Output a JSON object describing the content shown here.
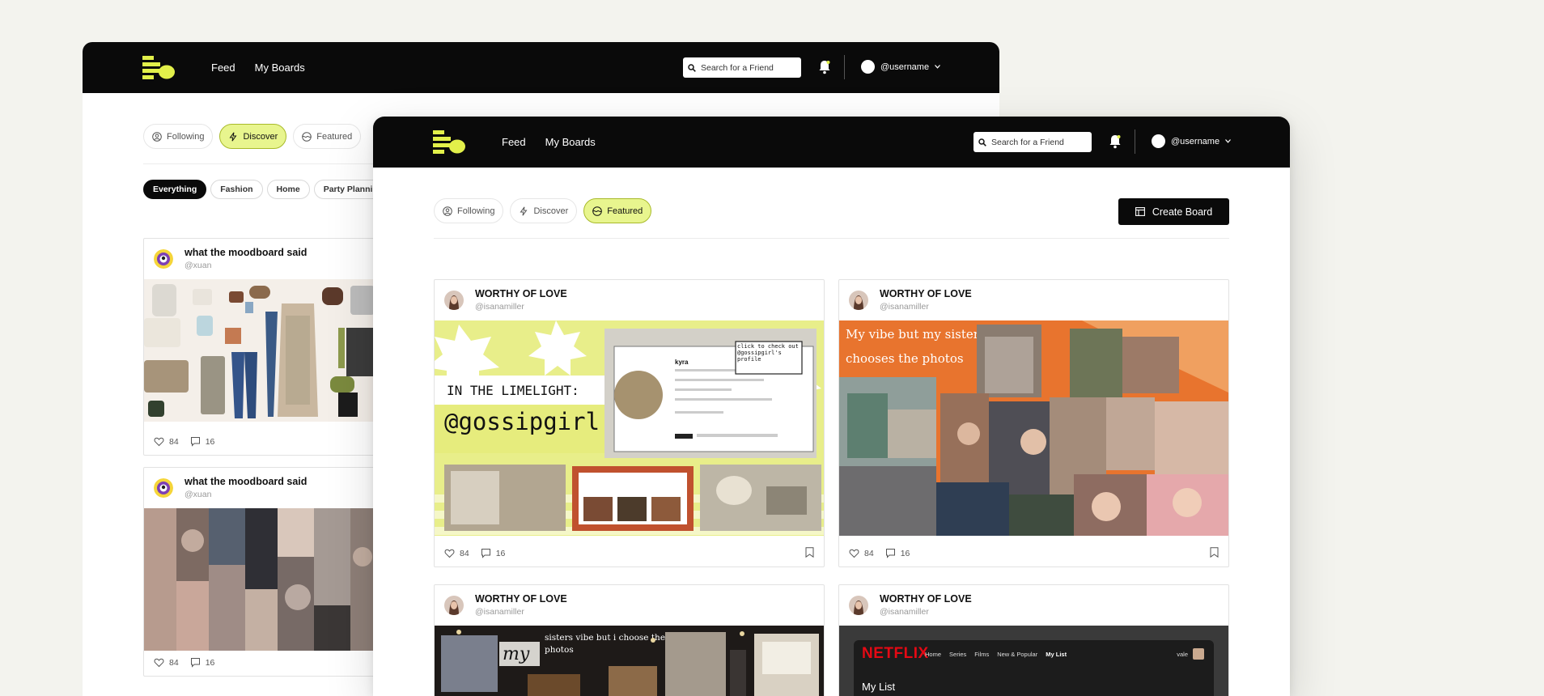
{
  "colors": {
    "accent": "#e8f58e",
    "dark": "#0a0a0a",
    "background": "#f3f3ee"
  },
  "nav": {
    "feed": "Feed",
    "boards": "My Boards"
  },
  "search": {
    "placeholder": "Search for a Friend"
  },
  "user": {
    "name": "@username"
  },
  "tabs": {
    "following": "Following",
    "discover": "Discover",
    "featured": "Featured"
  },
  "back": {
    "active_tab": "Discover",
    "chips": [
      "Everything",
      "Fashion",
      "Home",
      "Party Planning"
    ],
    "cards": [
      {
        "title": "what the moodboard said",
        "handle": "@xuan",
        "likes": "84",
        "comments": "16"
      },
      {
        "title": "what the moodboard said",
        "handle": "@xuan",
        "likes": "84",
        "comments": "16"
      }
    ]
  },
  "front": {
    "active_tab": "Featured",
    "create_label": "Create Board",
    "cards": [
      {
        "title": "WORTHY OF LOVE",
        "handle": "@isanamiller",
        "likes": "84",
        "comments": "16",
        "img_text1": "IN THE LIMELIGHT:",
        "img_text2": "@gossipgirl",
        "img_note": "click to check out @gossipgirl's profile",
        "img_name": "kyra"
      },
      {
        "title": "WORTHY OF LOVE",
        "handle": "@isanamiller",
        "likes": "84",
        "comments": "16",
        "img_text1": "My vibe but my sister",
        "img_text2": "chooses the photos"
      },
      {
        "title": "WORTHY OF LOVE",
        "handle": "@isanamiller",
        "img_text1": "my",
        "img_text2": "sisters vibe but i choose the photos"
      },
      {
        "title": "WORTHY OF LOVE",
        "handle": "@isanamiller",
        "img_brand": "NETFLIX",
        "img_nav": [
          "Home",
          "Series",
          "Films",
          "New & Popular",
          "My List"
        ],
        "img_user": "vale",
        "img_heading": "My List"
      }
    ]
  }
}
